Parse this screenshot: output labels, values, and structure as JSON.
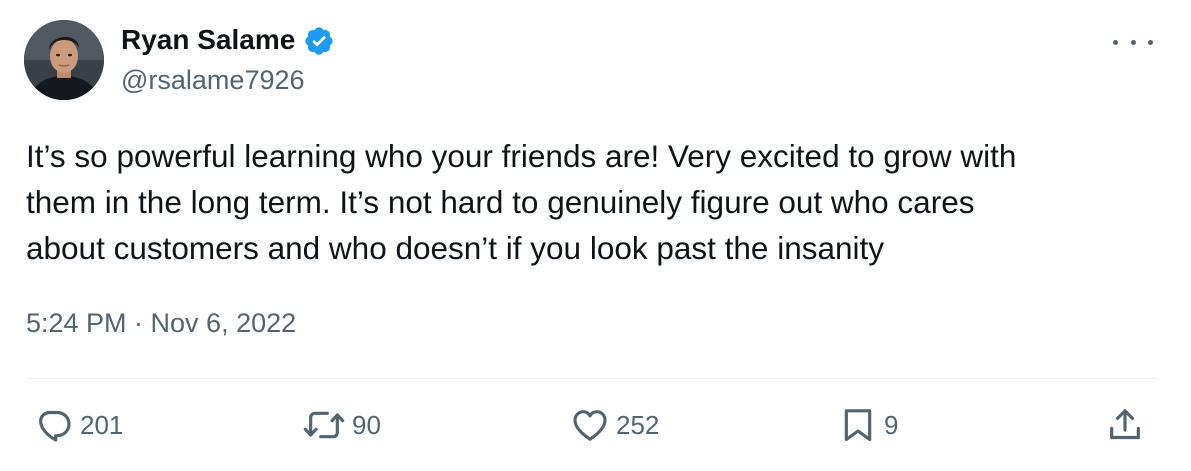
{
  "author": {
    "display_name": "Ryan Salame",
    "handle": "@rsalame7926",
    "verified": true,
    "verified_color": "#1d9bf0"
  },
  "tweet": {
    "text": "It’s so powerful learning who your friends are! Very excited to grow with\nthem in the long term. It’s not hard to genuinely figure out who cares\nabout customers and who doesn’t if you look past the insanity",
    "timestamp": "5:24 PM · Nov 6, 2022"
  },
  "actions": {
    "replies": "201",
    "retweets": "90",
    "likes": "252",
    "bookmarks": "9"
  },
  "icons": [
    "verified-badge-icon",
    "more-icon",
    "reply-icon",
    "retweet-icon",
    "like-icon",
    "bookmark-icon",
    "share-icon"
  ]
}
